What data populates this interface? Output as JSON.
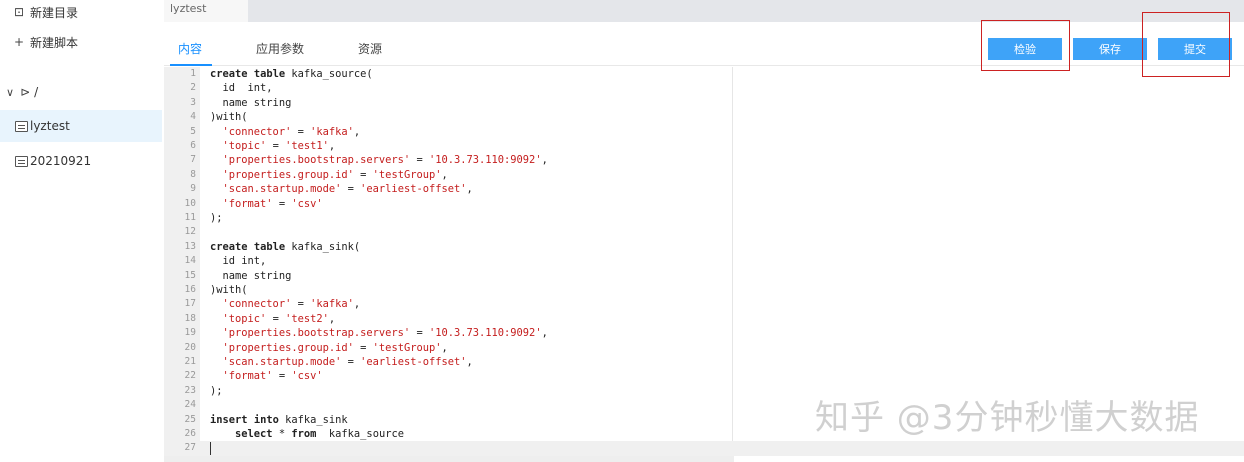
{
  "sidebar": {
    "new_dir_label": "新建目录",
    "new_script_label": "新建脚本",
    "root_label": "/",
    "files": [
      {
        "name": "lyztest",
        "active": true
      },
      {
        "name": "20210921",
        "active": false
      }
    ]
  },
  "tabs": {
    "open_file": "lyztest"
  },
  "subtabs": {
    "content": "内容",
    "params": "应用参数",
    "resources": "资源"
  },
  "toolbar": {
    "check_label": "检验",
    "save_label": "保存",
    "submit_label": "提交"
  },
  "editor": {
    "lines": [
      "create table kafka_source(",
      "  id  int,",
      "  name string",
      ")with(",
      "  'connector' = 'kafka',",
      "  'topic' = 'test1',",
      "  'properties.bootstrap.servers' = '10.3.73.110:9092',",
      "  'properties.group.id' = 'testGroup',",
      "  'scan.startup.mode' = 'earliest-offset',",
      "  'format' = 'csv'",
      ");",
      "",
      "create table kafka_sink(",
      "  id int,",
      "  name string",
      ")with(",
      "  'connector' = 'kafka',",
      "  'topic' = 'test2',",
      "  'properties.bootstrap.servers' = '10.3.73.110:9092',",
      "  'properties.group.id' = 'testGroup',",
      "  'scan.startup.mode' = 'earliest-offset',",
      "  'format' = 'csv'",
      ");",
      "",
      "insert into kafka_sink",
      "    select * from  kafka_source",
      ""
    ],
    "cursor_line": 27
  },
  "watermark": "知乎 @3分钟秒懂大数据",
  "colors": {
    "accent": "#1890ff",
    "button": "#3ea3f8",
    "highlight": "#cc2222",
    "string": "#c41d1d"
  }
}
